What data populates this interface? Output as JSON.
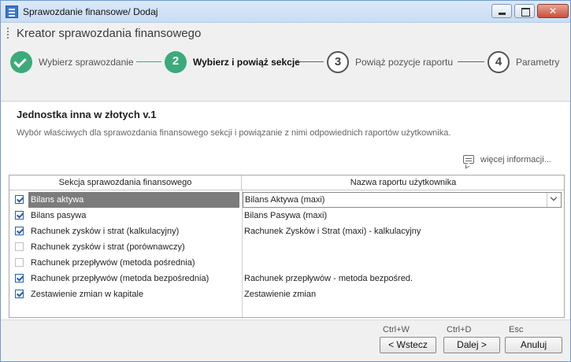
{
  "window": {
    "title": "Sprawozdanie finansowe/ Dodaj"
  },
  "wizard": {
    "title": "Kreator sprawozdania finansowego",
    "steps": [
      {
        "number": "1",
        "label": "Wybierz sprawozdanie",
        "state": "done"
      },
      {
        "number": "2",
        "label": "Wybierz i powiąż sekcje",
        "state": "active"
      },
      {
        "number": "3",
        "label": "Powiąż pozycje raportu",
        "state": "pending"
      },
      {
        "number": "4",
        "label": "Parametry",
        "state": "pending"
      }
    ]
  },
  "content": {
    "title": "Jednostka inna w złotych v.1",
    "description": "Wybór właściwych dla sprawozdania finansowego sekcji i powiązanie z nimi odpowiednich raportów użytkownika.",
    "more_info": "więcej informacji..."
  },
  "grid": {
    "columns": [
      "Sekcja sprawozdania finansowego",
      "Nazwa raportu użytkownika"
    ],
    "rows": [
      {
        "checked": true,
        "section": "Bilans aktywa",
        "report": "Bilans Aktywa (maxi)",
        "selected": true
      },
      {
        "checked": true,
        "section": "Bilans pasywa",
        "report": "Bilans Pasywa (maxi)",
        "selected": false
      },
      {
        "checked": true,
        "section": "Rachunek zysków i strat (kalkulacyjny)",
        "report": "Rachunek Zysków i Strat (maxi) - kalkulacyjny",
        "selected": false
      },
      {
        "checked": false,
        "section": "Rachunek zysków i strat (porównawczy)",
        "report": "",
        "selected": false
      },
      {
        "checked": false,
        "section": "Rachunek przepływów (metoda pośrednia)",
        "report": "",
        "selected": false
      },
      {
        "checked": true,
        "section": "Rachunek przepływów (metoda bezpośrednia)",
        "report": "Rachunek przepływów - metoda bezpośred.",
        "selected": false
      },
      {
        "checked": true,
        "section": "Zestawienie zmian w kapitale",
        "report": "Zestawienie zmian",
        "selected": false
      }
    ]
  },
  "footer": {
    "back": {
      "shortcut": "Ctrl+W",
      "label": "< Wstecz"
    },
    "next": {
      "shortcut": "Ctrl+D",
      "label": "Dalej >"
    },
    "cancel": {
      "shortcut": "Esc",
      "label": "Anuluj"
    }
  },
  "colors": {
    "accent_green": "#3caa7a",
    "selection_gray": "#7c7c7c",
    "check_blue": "#2a5fa8"
  }
}
